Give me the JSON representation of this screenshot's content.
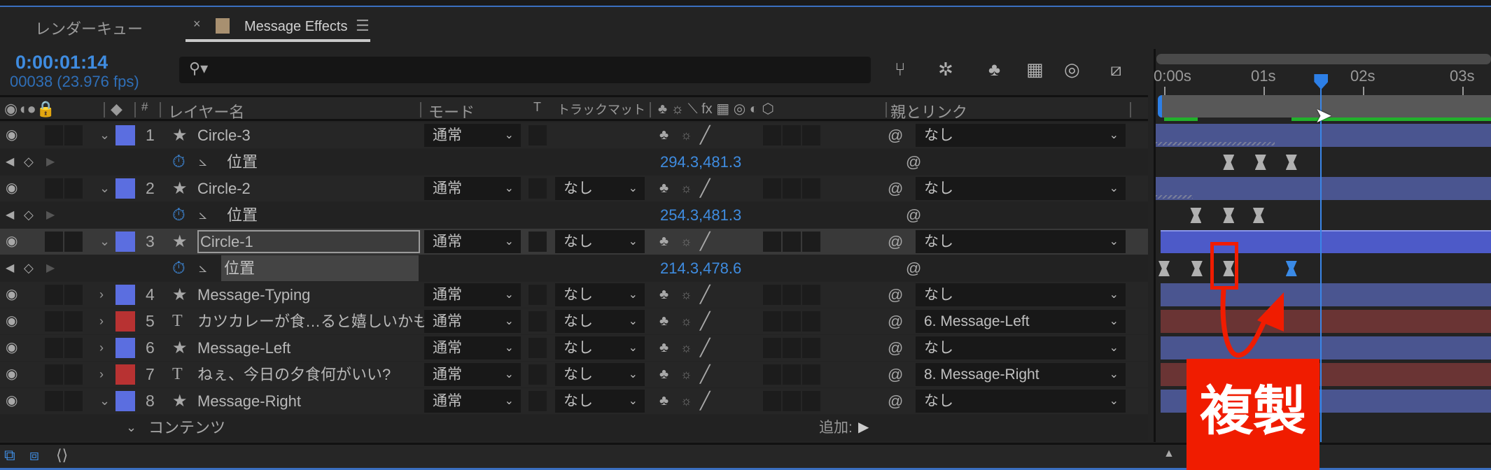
{
  "tabs": [
    {
      "label": "レンダーキュー"
    },
    {
      "label": "Message Effects",
      "close": "×",
      "menu": "☰"
    }
  ],
  "time": {
    "timecode": "0:00:01:14",
    "frames": "00038 (23.976 fps)"
  },
  "search": {
    "icon": "⚲▾"
  },
  "header": {
    "num": "#",
    "name": "レイヤー名",
    "mode": "モード",
    "t": "T",
    "matte": "トラックマット",
    "parent": "親とリンク",
    "switches": "♣ ☼ ⟍ fx ▦ ◎ ◐ ⬡"
  },
  "ruler": [
    "0:00s",
    "01s",
    "02s",
    "03s"
  ],
  "playhead_seconds": 1.58,
  "rows": [
    {
      "type": "layer",
      "num": "1",
      "icon": "★",
      "name": "Circle-3",
      "color": "#5b6ee0",
      "mode": "通常",
      "matte": null,
      "parent": "なし",
      "expanded": true,
      "bar": "#4a5590",
      "barStart": 0,
      "hatch": 1.2
    },
    {
      "type": "prop",
      "name": "位置",
      "value": "294.3,481.3",
      "keys": [
        0.65,
        0.97,
        1.28
      ],
      "blue": []
    },
    {
      "type": "layer",
      "num": "2",
      "icon": "★",
      "name": "Circle-2",
      "color": "#5b6ee0",
      "mode": "通常",
      "matte": "なし",
      "parent": "なし",
      "expanded": true,
      "bar": "#4a5590",
      "barStart": 0,
      "hatch": 0.37
    },
    {
      "type": "prop",
      "name": "位置",
      "value": "254.3,481.3",
      "keys": [
        0.32,
        0.65,
        0.95
      ],
      "blue": []
    },
    {
      "type": "layer",
      "num": "3",
      "icon": "★",
      "name": "Circle-1",
      "color": "#5b6ee0",
      "mode": "通常",
      "matte": "なし",
      "parent": "なし",
      "expanded": true,
      "selected": true,
      "bar": "#4d5ac8",
      "barStart": 0.05
    },
    {
      "type": "prop",
      "name": "位置",
      "value": "214.3,478.6",
      "keys": [
        0,
        0.33,
        0.65
      ],
      "blue": [
        1.28
      ],
      "selected": true
    },
    {
      "type": "layer",
      "num": "4",
      "icon": "★",
      "name": "Message-Typing",
      "color": "#5b6ee0",
      "mode": "通常",
      "matte": "なし",
      "parent": "なし",
      "bar": "#4a5590",
      "barStart": 0.05
    },
    {
      "type": "layer",
      "num": "5",
      "icon": "T",
      "name": "カツカレーが食…ると嬉しいかも。",
      "color": "#b83232",
      "mode": "通常",
      "matte": "なし",
      "parent": "6. Message-Left",
      "bar": "#6a3434",
      "barStart": 0.05
    },
    {
      "type": "layer",
      "num": "6",
      "icon": "★",
      "name": "Message-Left",
      "color": "#5b6ee0",
      "mode": "通常",
      "matte": "なし",
      "parent": "なし",
      "bar": "#4a5590",
      "barStart": 0.05
    },
    {
      "type": "layer",
      "num": "7",
      "icon": "T",
      "name": "ねぇ、今日の夕食何がいい?",
      "color": "#b83232",
      "mode": "通常",
      "matte": "なし",
      "parent": "8. Message-Right",
      "bar": "#6a3434",
      "barStart": 0.05
    },
    {
      "type": "layer",
      "num": "8",
      "icon": "★",
      "name": "Message-Right",
      "color": "#5b6ee0",
      "mode": "通常",
      "matte": "なし",
      "parent": "なし",
      "expanded": true,
      "bar": "#4a5590",
      "barStart": 0.05
    },
    {
      "type": "group",
      "name": "コンテンツ",
      "add": "追加:"
    }
  ],
  "annotation": {
    "label": "複製",
    "color": "#f01c00"
  }
}
